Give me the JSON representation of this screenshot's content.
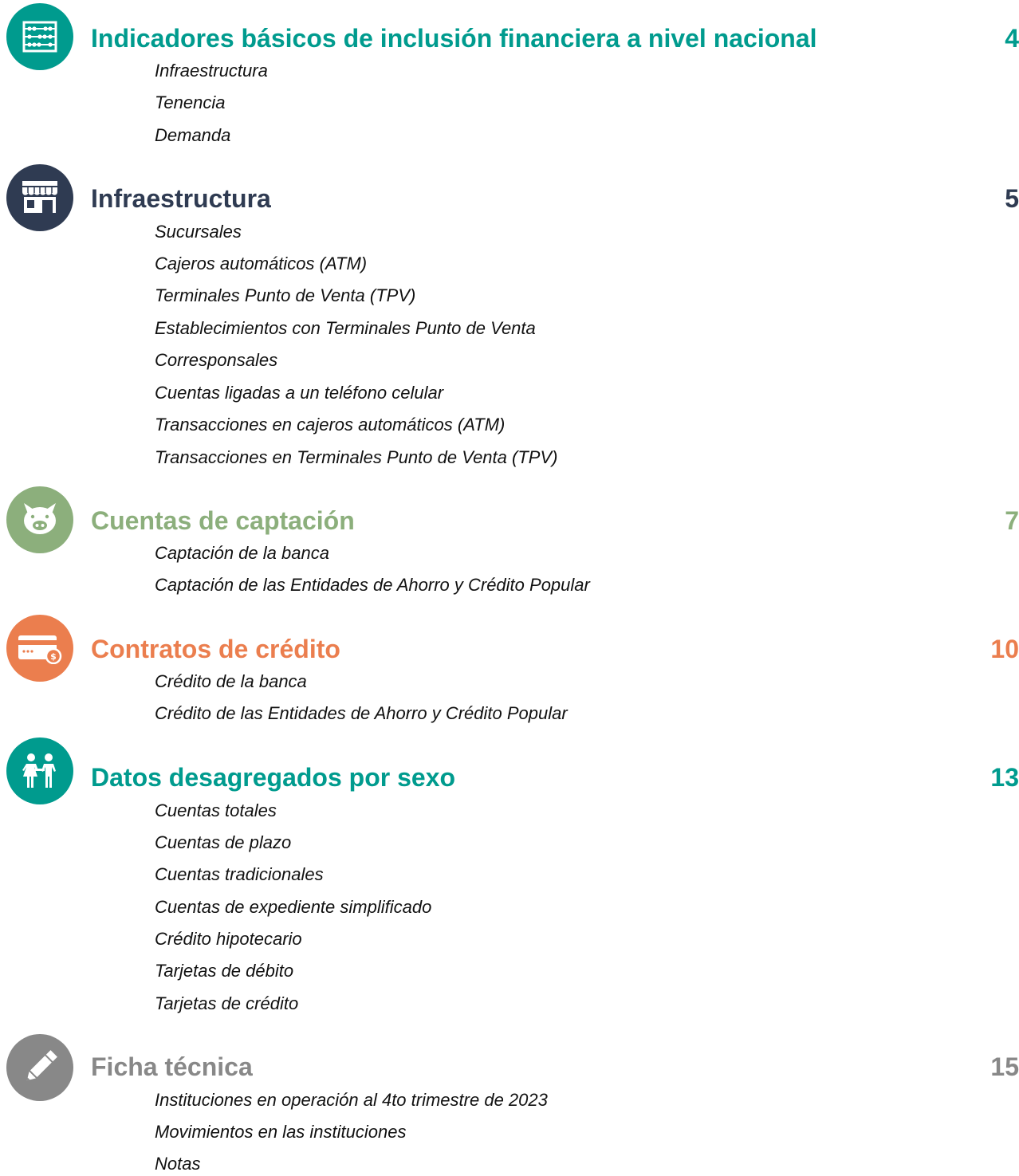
{
  "colors": {
    "teal": "#009B8E",
    "navy": "#2F3B52",
    "sage": "#8CAF7C",
    "orange": "#EB7E4E",
    "gray": "#888888"
  },
  "sections": [
    {
      "title": "Indicadores básicos de inclusión financiera a nivel nacional",
      "page": "4",
      "icon": "abacus-icon",
      "items": [
        "Infraestructura",
        "Tenencia",
        "Demanda"
      ]
    },
    {
      "title": "Infraestructura",
      "page": "5",
      "icon": "storefront-icon",
      "items": [
        "Sucursales",
        "Cajeros automáticos (ATM)",
        "Terminales Punto de Venta (TPV)",
        "Establecimientos con Terminales Punto de Venta",
        "Corresponsales",
        "Cuentas ligadas a un teléfono celular",
        "Transacciones en cajeros automáticos (ATM)",
        "Transacciones en Terminales Punto de Venta (TPV)"
      ]
    },
    {
      "title": "Cuentas de captación",
      "page": "7",
      "icon": "piggy-bank-icon",
      "items": [
        "Captación de la banca",
        "Captación de las Entidades de Ahorro y Crédito Popular"
      ]
    },
    {
      "title": "Contratos de crédito",
      "page": "10",
      "icon": "credit-card-icon",
      "items": [
        "Crédito de la banca",
        "Crédito de las Entidades de Ahorro y Crédito Popular"
      ]
    },
    {
      "title": "Datos desagregados por sexo",
      "page": "13",
      "icon": "people-icon",
      "items": [
        "Cuentas totales",
        "Cuentas de plazo",
        "Cuentas tradicionales",
        "Cuentas de expediente simplificado",
        "Crédito hipotecario",
        "Tarjetas de débito",
        "Tarjetas de crédito"
      ]
    },
    {
      "title": "Ficha técnica",
      "page": "15",
      "icon": "pencil-icon",
      "items": [
        "Instituciones en operación al 4to trimestre de 2023",
        "Movimientos en las instituciones",
        "Notas"
      ]
    }
  ]
}
